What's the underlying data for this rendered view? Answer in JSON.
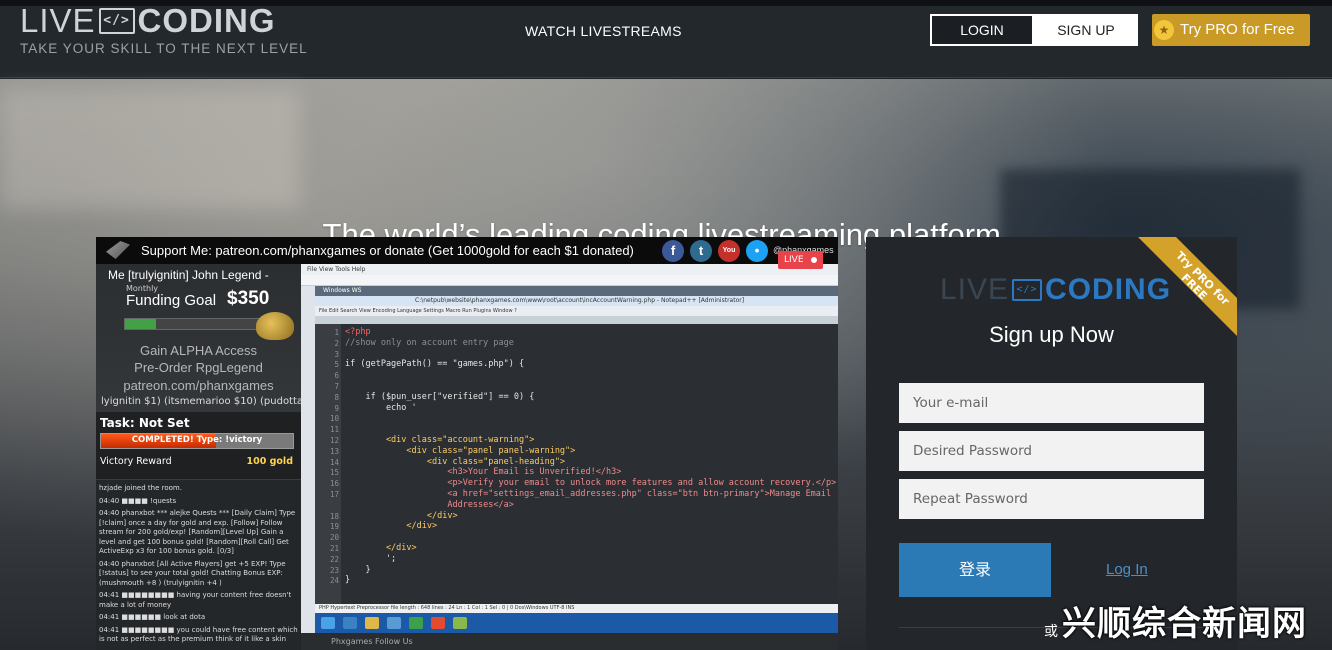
{
  "header": {
    "logo_live": "LIVE",
    "logo_coding": "CODING",
    "logo_monitor": "</>",
    "tagline": "TAKE YOUR SKILL TO THE NEXT LEVEL",
    "nav_watch": "WATCH LIVESTREAMS",
    "login": "LOGIN",
    "signup": "SIGN UP",
    "pro": "Try PRO for Free"
  },
  "hero": {
    "title": "The world’s leading coding livestreaming platform."
  },
  "stream": {
    "banner": "Support Me: patreon.com/phanxgames or donate (Get 1000gold for each $1 donated)",
    "social": [
      "f",
      "t",
      "You",
      "•"
    ],
    "social_colors": [
      "#3b5998",
      "#2f6a8f",
      "#c4302b",
      "#1da1f2"
    ],
    "handle": "@phanxgames",
    "live": "LIVE",
    "side": {
      "me": "Me [trulyignitin]   John Legend -",
      "monthly": "Monthly",
      "funding": "Funding  Goal",
      "amount": "$350",
      "funding_progress": 0.22,
      "gain1": "Gain  ALPHA  Access",
      "gain2": "Pre-Order  RpgLegend",
      "patreon": "patreon.com/phanxgames",
      "donors": "lyignitin $1)  (itsmemarioo $10)  (pudotta",
      "task_title": "Task: Not Set",
      "task_bar": "COMPLETED!  Type:  !victory",
      "task_progress": 0.6,
      "reward_label": "Victory Reward",
      "reward_value": "100 gold"
    },
    "chat": [
      "hzjade joined the room.",
      "04:40  ■■■■ !quests",
      "04:40  phanxbot  *** alejke Quests ***  [Daily Claim] Type [!claim] once a day for gold and exp.  [Follow] Follow stream for 200 gold/exp!  [Random][Level Up] Gain a level and get 100 bonus gold!  [Random][Roll Call] Get ActiveExp x3 for 100 bonus gold. [0/3]",
      "04:40  phanxbot  [All Active Players] get +5 EXP! Type [!status] to see your total gold! Chatting Bonus EXP: (mushmouth +8 ) (trulyignitin +4 )",
      "04:41  ■■■■■■■■  having your content free doesn't make a lot of money",
      "04:41  ■■■■■■  look at dota",
      "04:41  ■■■■■■■■  you could have free content which is not as perfect as the premium think of it like a skin"
    ],
    "ide": {
      "menu": "File   View   Tools   Help",
      "window": "Windows WS",
      "title": "C:\\netpub\\website\\phanxgames.com\\www\\root\\account\\incAccountWarning.php - Notepad++ [Administrator]",
      "tools": "File  Edit  Search  View  Encoding  Language  Settings  Macro  Run  Plugins  Window  ?",
      "status": "PHP Hypertext Preprocessor file        length : 648    lines : 24        Ln : 1    Col : 1    Sel : 0 | 0        Dos\\Windows        UTF-8        INS",
      "bottom": "Phxgames                                   Follow Us",
      "lines": [
        {
          "n": "1",
          "code": "<?php",
          "cls": "k-php"
        },
        {
          "n": "2",
          "code": "//show only on account entry page",
          "cls": "k-cm"
        },
        {
          "n": "3",
          "code": "",
          "cls": ""
        },
        {
          "n": "5",
          "code": "if (getPagePath() == \"games.php\") {",
          "cls": ""
        },
        {
          "n": "6",
          "code": "",
          "cls": ""
        },
        {
          "n": "7",
          "code": "",
          "cls": ""
        },
        {
          "n": "8",
          "code": "    if ($pun_user[\"verified\"] == 0) {",
          "cls": ""
        },
        {
          "n": "9",
          "code": "        echo '",
          "cls": ""
        },
        {
          "n": "10",
          "code": "",
          "cls": ""
        },
        {
          "n": "11",
          "code": "",
          "cls": ""
        },
        {
          "n": "12",
          "code": "        <div class=\"account-warning\">",
          "cls": "k-tag"
        },
        {
          "n": "13",
          "code": "            <div class=\"panel panel-warning\">",
          "cls": "k-tag"
        },
        {
          "n": "14",
          "code": "                <div class=\"panel-heading\">",
          "cls": "k-tag"
        },
        {
          "n": "15",
          "code": "                    <h3>Your Email is Unverified!</h3>",
          "cls": "k-st"
        },
        {
          "n": "16",
          "code": "                    <p>Verify your email to unlock more features and allow account recovery.</p>",
          "cls": "k-st"
        },
        {
          "n": "17",
          "code": "                    <a href=\"settings_email_addresses.php\" class=\"btn btn-primary\">Manage Email",
          "cls": "k-st"
        },
        {
          "n": "",
          "code": "                    Addresses</a>",
          "cls": "k-st"
        },
        {
          "n": "18",
          "code": "                </div>",
          "cls": "k-tag"
        },
        {
          "n": "19",
          "code": "            </div>",
          "cls": "k-tag"
        },
        {
          "n": "20",
          "code": "",
          "cls": ""
        },
        {
          "n": "21",
          "code": "        </div>",
          "cls": "k-tag"
        },
        {
          "n": "22",
          "code": "        ';",
          "cls": ""
        },
        {
          "n": "23",
          "code": "    }",
          "cls": ""
        },
        {
          "n": "24",
          "code": "}",
          "cls": ""
        }
      ]
    }
  },
  "signup": {
    "ribbon": "Try PRO for FREE",
    "logo_live": "LIVE",
    "logo_coding": "CODING",
    "logo_monitor": "</>",
    "title": "Sign up Now",
    "email_placeholder": "Your e-mail",
    "password_placeholder": "Desired Password",
    "repeat_placeholder": "Repeat Password",
    "submit": "登录",
    "login_link": "Log In"
  },
  "watermark": {
    "or": "或",
    "text": "兴顺综合新闻网"
  },
  "colors": {
    "accent_blue": "#2b79b5",
    "pro_gold": "#c99a25",
    "live_red": "#e8424a"
  }
}
